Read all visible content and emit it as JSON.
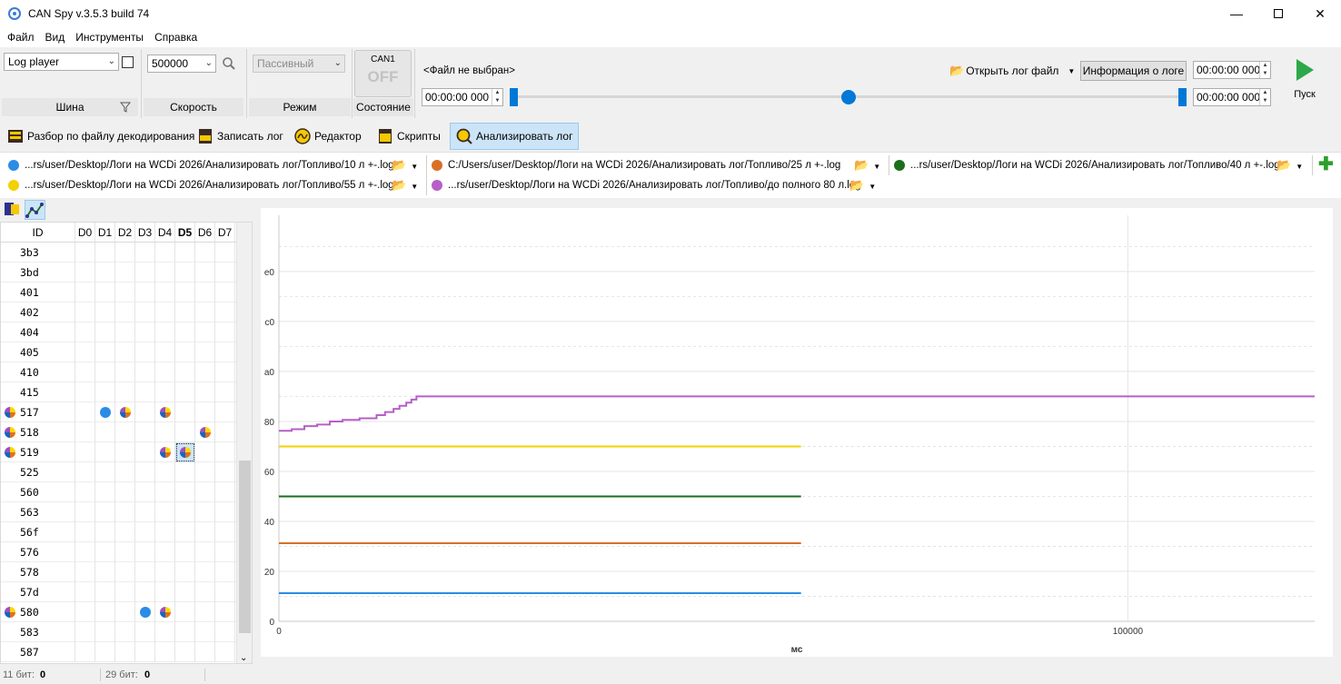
{
  "window": {
    "title": "CAN Spy v.3.5.3 build 74"
  },
  "menu": [
    "Файл",
    "Вид",
    "Инструменты",
    "Справка"
  ],
  "toolbar": {
    "bus": {
      "value": "Log player",
      "label": "Шина"
    },
    "speed": {
      "value": "500000",
      "label": "Скорость"
    },
    "mode": {
      "value": "Пассивный",
      "label": "Режим"
    },
    "state": {
      "channel": "CAN1",
      "status": "OFF",
      "label": "Состояние"
    },
    "file_label": "<Файл не выбран>",
    "start_time": "00:00:00 000",
    "open_log": "Открыть лог файл",
    "log_info": "Информация о логе",
    "end_time_top": "00:00:00 000",
    "end_time_bottom": "00:00:00 000",
    "play_label": "Пуск"
  },
  "tabs": [
    {
      "label": "Разбор по файлу декодирования",
      "icon": "decode-icon"
    },
    {
      "label": "Записать лог",
      "icon": "log-icon"
    },
    {
      "label": "Редактор",
      "icon": "editor-icon"
    },
    {
      "label": "Скрипты",
      "icon": "script-icon"
    },
    {
      "label": "Анализировать лог",
      "icon": "analyze-icon",
      "active": true
    }
  ],
  "logs": [
    {
      "color": "#2b8ce6",
      "path": "...rs/user/Desktop/Логи на WCDi 2026/Анализировать лог/Топливо/10 л +-.log"
    },
    {
      "color": "#d86f27",
      "path": "C:/Users/user/Desktop/Логи на WCDi 2026/Анализировать лог/Топливо/25 л +-.log"
    },
    {
      "color": "#1b6e1b",
      "path": "...rs/user/Desktop/Логи на WCDi 2026/Анализировать лог/Топливо/40 л +-.log"
    },
    {
      "color": "#f5d000",
      "path": "...rs/user/Desktop/Логи на WCDi 2026/Анализировать лог/Топливо/55 л +-.log"
    },
    {
      "color": "#b65fc8",
      "path": "...rs/user/Desktop/Логи на WCDi 2026/Анализировать лог/Топливо/до полного 80 л.log"
    }
  ],
  "grid": {
    "headers": [
      "ID",
      "D0",
      "D1",
      "D2",
      "D3",
      "D4",
      "D5",
      "D6",
      "D7"
    ],
    "rows": [
      {
        "id": "3b3",
        "mark": false,
        "cells": [
          "",
          "",
          "",
          "",
          "",
          "",
          "",
          ""
        ]
      },
      {
        "id": "3bd",
        "mark": false,
        "cells": [
          "",
          "",
          "",
          "",
          "",
          "",
          "",
          ""
        ]
      },
      {
        "id": "401",
        "mark": false,
        "cells": [
          "",
          "",
          "",
          "",
          "",
          "",
          "",
          ""
        ]
      },
      {
        "id": "402",
        "mark": false,
        "cells": [
          "",
          "",
          "",
          "",
          "",
          "",
          "",
          ""
        ]
      },
      {
        "id": "404",
        "mark": false,
        "cells": [
          "",
          "",
          "",
          "",
          "",
          "",
          "",
          ""
        ]
      },
      {
        "id": "405",
        "mark": false,
        "cells": [
          "",
          "",
          "",
          "",
          "",
          "",
          "",
          ""
        ]
      },
      {
        "id": "410",
        "mark": false,
        "cells": [
          "",
          "",
          "",
          "",
          "",
          "",
          "",
          ""
        ]
      },
      {
        "id": "415",
        "mark": false,
        "cells": [
          "",
          "",
          "",
          "",
          "",
          "",
          "",
          ""
        ]
      },
      {
        "id": "517",
        "mark": true,
        "cells": [
          "",
          "dot",
          "pie",
          "",
          "pie",
          "",
          "",
          ""
        ]
      },
      {
        "id": "518",
        "mark": true,
        "cells": [
          "",
          "",
          "",
          "",
          "",
          "",
          "pie",
          ""
        ]
      },
      {
        "id": "519",
        "mark": true,
        "cells": [
          "",
          "",
          "",
          "",
          "pie",
          "pie-sel",
          "",
          ""
        ]
      },
      {
        "id": "525",
        "mark": false,
        "cells": [
          "",
          "",
          "",
          "",
          "",
          "",
          "",
          ""
        ]
      },
      {
        "id": "560",
        "mark": false,
        "cells": [
          "",
          "",
          "",
          "",
          "",
          "",
          "",
          ""
        ]
      },
      {
        "id": "563",
        "mark": false,
        "cells": [
          "",
          "",
          "",
          "",
          "",
          "",
          "",
          ""
        ]
      },
      {
        "id": "56f",
        "mark": false,
        "cells": [
          "",
          "",
          "",
          "",
          "",
          "",
          "",
          ""
        ]
      },
      {
        "id": "576",
        "mark": false,
        "cells": [
          "",
          "",
          "",
          "",
          "",
          "",
          "",
          ""
        ]
      },
      {
        "id": "578",
        "mark": false,
        "cells": [
          "",
          "",
          "",
          "",
          "",
          "",
          "",
          ""
        ]
      },
      {
        "id": "57d",
        "mark": false,
        "cells": [
          "",
          "",
          "",
          "",
          "",
          "",
          "",
          ""
        ]
      },
      {
        "id": "580",
        "mark": true,
        "cells": [
          "",
          "",
          "",
          "dot",
          "pie",
          "",
          "",
          ""
        ]
      },
      {
        "id": "583",
        "mark": false,
        "cells": [
          "",
          "",
          "",
          "",
          "",
          "",
          "",
          ""
        ]
      },
      {
        "id": "587",
        "mark": false,
        "cells": [
          "",
          "",
          "",
          "",
          "",
          "",
          "",
          ""
        ]
      }
    ]
  },
  "chart_data": {
    "type": "line",
    "xlabel": "мс",
    "ylabel": "",
    "xlim": [
      0,
      122000
    ],
    "ylim": [
      0,
      260
    ],
    "x_ticks": [
      0,
      100000
    ],
    "x_tick_labels": [
      "0",
      "100000"
    ],
    "y_ticks": [
      0,
      32,
      64,
      96,
      128,
      160,
      192,
      224
    ],
    "y_tick_labels": [
      "0",
      "20",
      "40",
      "60",
      "80",
      "a0",
      "c0",
      "e0"
    ],
    "grid": true,
    "series": [
      {
        "color": "#2b8ce6",
        "x": [
          0,
          61500
        ],
        "y": [
          18,
          18
        ]
      },
      {
        "color": "#d86f27",
        "x": [
          0,
          61500
        ],
        "y": [
          50,
          50
        ]
      },
      {
        "color": "#1b6e1b",
        "x": [
          0,
          61500
        ],
        "y": [
          80,
          80
        ]
      },
      {
        "color": "#f5d000",
        "x": [
          0,
          61500
        ],
        "y": [
          112,
          112
        ]
      },
      {
        "color": "#b65fc8",
        "x": [
          0,
          1500,
          3000,
          4500,
          6000,
          7500,
          9500,
          11500,
          12500,
          13500,
          14200,
          15000,
          15600,
          16200,
          122000
        ],
        "y": [
          122,
          123,
          125,
          126,
          128,
          129,
          130,
          132,
          134,
          136,
          138,
          140,
          142,
          144,
          144
        ]
      }
    ]
  },
  "status": {
    "bits11_label": "11 бит:",
    "bits11_value": "0",
    "bits29_label": "29 бит:",
    "bits29_value": "0"
  }
}
